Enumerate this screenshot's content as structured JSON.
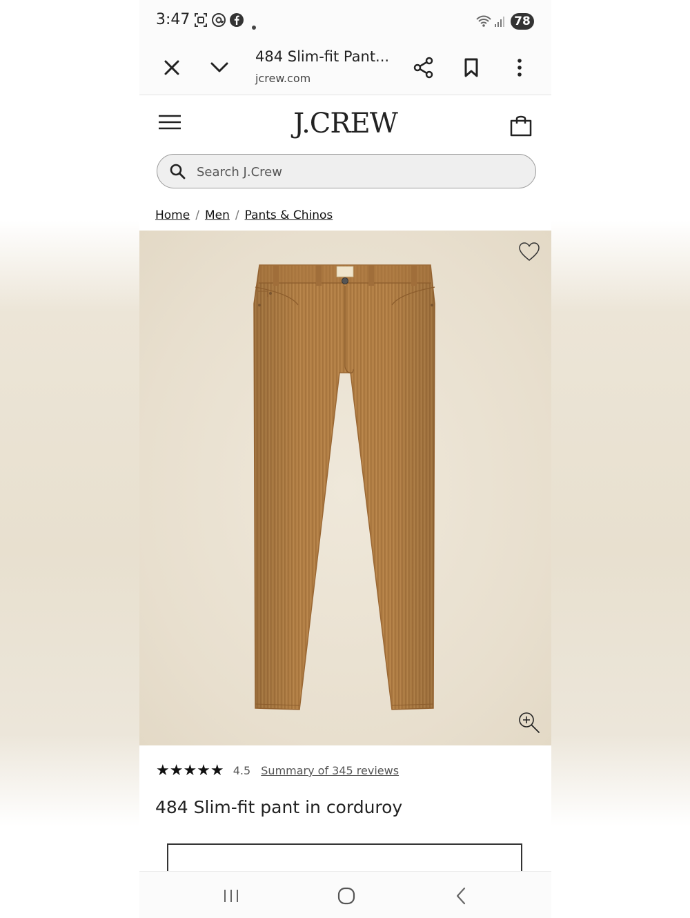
{
  "status_bar": {
    "time": "3:47",
    "battery": "78",
    "icons": [
      "screenshot-icon",
      "threads-icon",
      "facebook-icon",
      "dot-icon",
      "wifi-icon",
      "signal-icon",
      "battery-icon"
    ]
  },
  "browser": {
    "tab_title": "484 Slim-fit Pant...",
    "url": "jcrew.com",
    "icons": [
      "close-icon",
      "chevron-down-icon",
      "share-icon",
      "bookmark-icon",
      "more-vert-icon"
    ]
  },
  "header": {
    "logo": "J.CREW",
    "icons": [
      "menu-icon",
      "shopping-bag-icon"
    ]
  },
  "search": {
    "placeholder": "Search J.Crew"
  },
  "breadcrumb": {
    "items": [
      "Home",
      "Men",
      "Pants & Chinos"
    ],
    "separator": "/"
  },
  "product": {
    "rating": 4.5,
    "rating_label": "4.5",
    "stars_display": "★★★★★",
    "reviews_link": "Summary of 345 reviews",
    "name": "484 Slim-fit pant in corduroy",
    "image_icons": [
      "heart-icon",
      "zoom-in-icon"
    ],
    "image_background": "#e9e0cf",
    "product_color": "#b27f45"
  },
  "nav": {
    "icons": [
      "recents-icon",
      "home-icon",
      "back-icon"
    ]
  }
}
